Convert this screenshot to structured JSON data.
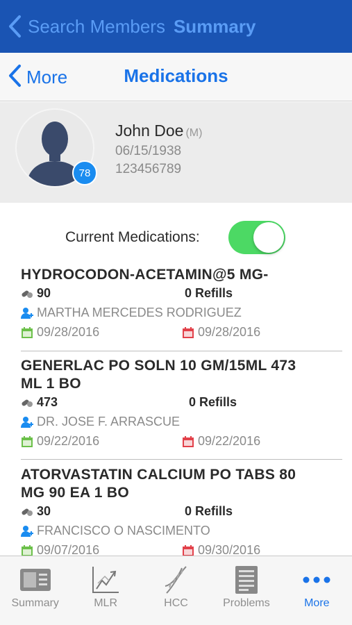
{
  "top_bar": {
    "back_label": "Search Members",
    "title": "Summary"
  },
  "nav_bar": {
    "back_label": "More",
    "title": "Medications"
  },
  "patient": {
    "name": "John Doe",
    "gender": "(M)",
    "dob": "06/15/1938",
    "member_id": "123456789",
    "badge": "78"
  },
  "filter": {
    "label": "Current Medications:",
    "enabled": true
  },
  "medications": [
    {
      "name": "HYDROCODON-ACETAMIN@5 MG-",
      "quantity": "90",
      "refills": "0 Refills",
      "prescriber": "MARTHA MERCEDES RODRIGUEZ",
      "start_date": "09/28/2016",
      "end_date": "09/28/2016"
    },
    {
      "name": "GENERLAC PO SOLN 10 GM/15ML 473 ML 1 BO",
      "quantity": "473",
      "refills": "0 Refills",
      "prescriber": "DR. JOSE F. ARRASCUE",
      "start_date": "09/22/2016",
      "end_date": "09/22/2016"
    },
    {
      "name": "ATORVASTATIN CALCIUM PO TABS 80 MG 90 EA 1 BO",
      "quantity": "30",
      "refills": "0 Refills",
      "prescriber": "FRANCISCO O NASCIMENTO",
      "start_date": "09/07/2016",
      "end_date": "09/30/2016"
    }
  ],
  "tab_bar": {
    "tabs": [
      {
        "label": "Summary",
        "icon": "summary-card-icon"
      },
      {
        "label": "MLR",
        "icon": "chart-trend-icon"
      },
      {
        "label": "HCC",
        "icon": "dna-icon"
      },
      {
        "label": "Problems",
        "icon": "list-document-icon"
      },
      {
        "label": "More",
        "icon": "more-dots-icon"
      }
    ],
    "active": "More"
  },
  "colors": {
    "top_bar_bg": "#1a54b3",
    "accent": "#1a73e8",
    "toggle_on": "#4cd964",
    "start_date_icon": "#6cc04a",
    "end_date_icon": "#e2414a",
    "badge": "#1a8cf0"
  }
}
